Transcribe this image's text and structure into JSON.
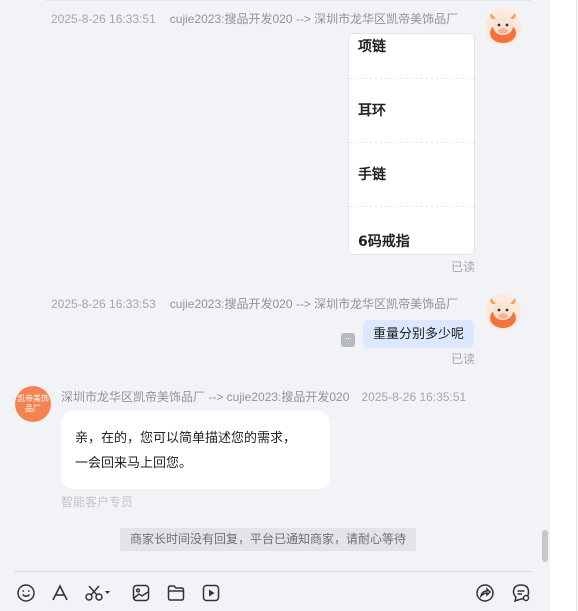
{
  "messages": {
    "first": {
      "timestamp": "2025-8-26 16:33:51",
      "route": "cujie2023:搜品开发020 --> 深圳市龙华区凯帝美饰品厂",
      "products": [
        "项链",
        "耳环",
        "手链",
        "6码戒指"
      ],
      "read_status": "已读"
    },
    "second": {
      "timestamp": "2025-8-26 16:33:53",
      "route": "cujie2023:搜品开发020 --> 深圳市龙华区凯帝美饰品厂",
      "text": "重量分别多少呢",
      "read_status": "已读"
    },
    "third": {
      "route": "深圳市龙华区凯帝美饰品厂 --> cujie2023:搜品开发020",
      "timestamp": "2025-8-26 16:35:51",
      "avatar_text": "凯帝美饰品厂",
      "line1": "亲，在的，您可以简单描述您的需求，",
      "line2": "一会回来马上回您。",
      "agent_label": "智能客户专员"
    }
  },
  "notice": "商家长时间没有回复，平台已通知商家，请耐心等待",
  "toolbar": {
    "left_icons": [
      "emoji-icon",
      "font-icon",
      "scissors-icon",
      "image-icon",
      "folder-icon",
      "video-icon"
    ],
    "right_icons": [
      "share-icon",
      "chat-settings-icon"
    ]
  },
  "colors": {
    "panel_bg": "#f2f3f7",
    "sent_bubble": "#dbe8ff",
    "avatar_orange": "#f5834f"
  }
}
